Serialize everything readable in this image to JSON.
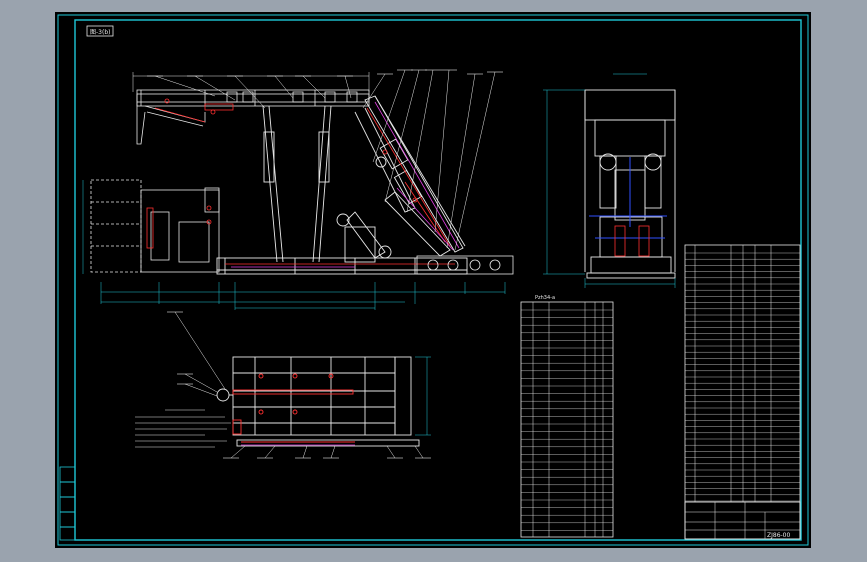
{
  "drawing": {
    "view_label": "图-3(b)",
    "parts_table_title": "Pzh34-a"
  },
  "title_block": {
    "drawing_code": "ZJ86-00"
  },
  "colors": {
    "background": "#000000",
    "frame": "#1ec8d8",
    "linework": "#e8e8e8",
    "highlight_red": "#ff3030",
    "highlight_blue": "#3050ff",
    "highlight_magenta": "#e040e0",
    "window_bg": "#9aa3ae"
  }
}
